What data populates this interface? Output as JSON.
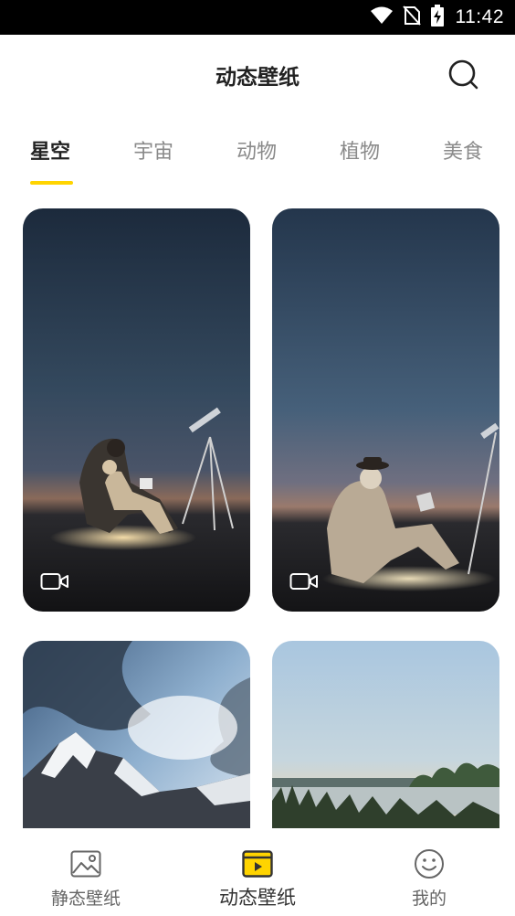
{
  "status_bar": {
    "time": "11:42",
    "icons": [
      "wifi-icon",
      "no-sim-icon",
      "battery-charging-icon"
    ]
  },
  "header": {
    "title": "动态壁纸",
    "search_icon": "search-icon"
  },
  "tabs": [
    {
      "label": "星空",
      "active": true
    },
    {
      "label": "宇宙",
      "active": false
    },
    {
      "label": "动物",
      "active": false
    },
    {
      "label": "植物",
      "active": false
    },
    {
      "label": "美食",
      "active": false
    }
  ],
  "wallpapers": [
    {
      "scene": "stargazers-with-telescope-night",
      "video": true
    },
    {
      "scene": "stargazers-laptop-dusk",
      "video": true
    },
    {
      "scene": "snowy-mountain-clouds",
      "video": false
    },
    {
      "scene": "lake-at-dusk",
      "video": false
    }
  ],
  "bottom_nav": {
    "items": [
      {
        "label": "静态壁纸",
        "icon": "image-icon",
        "active": false
      },
      {
        "label": "动态壁纸",
        "icon": "video-wallpaper-icon",
        "active": true
      },
      {
        "label": "我的",
        "icon": "smiley-icon",
        "active": false
      }
    ]
  },
  "colors": {
    "accent": "#ffd400",
    "title": "#222222",
    "inactive_tab": "#8a8a8a"
  }
}
